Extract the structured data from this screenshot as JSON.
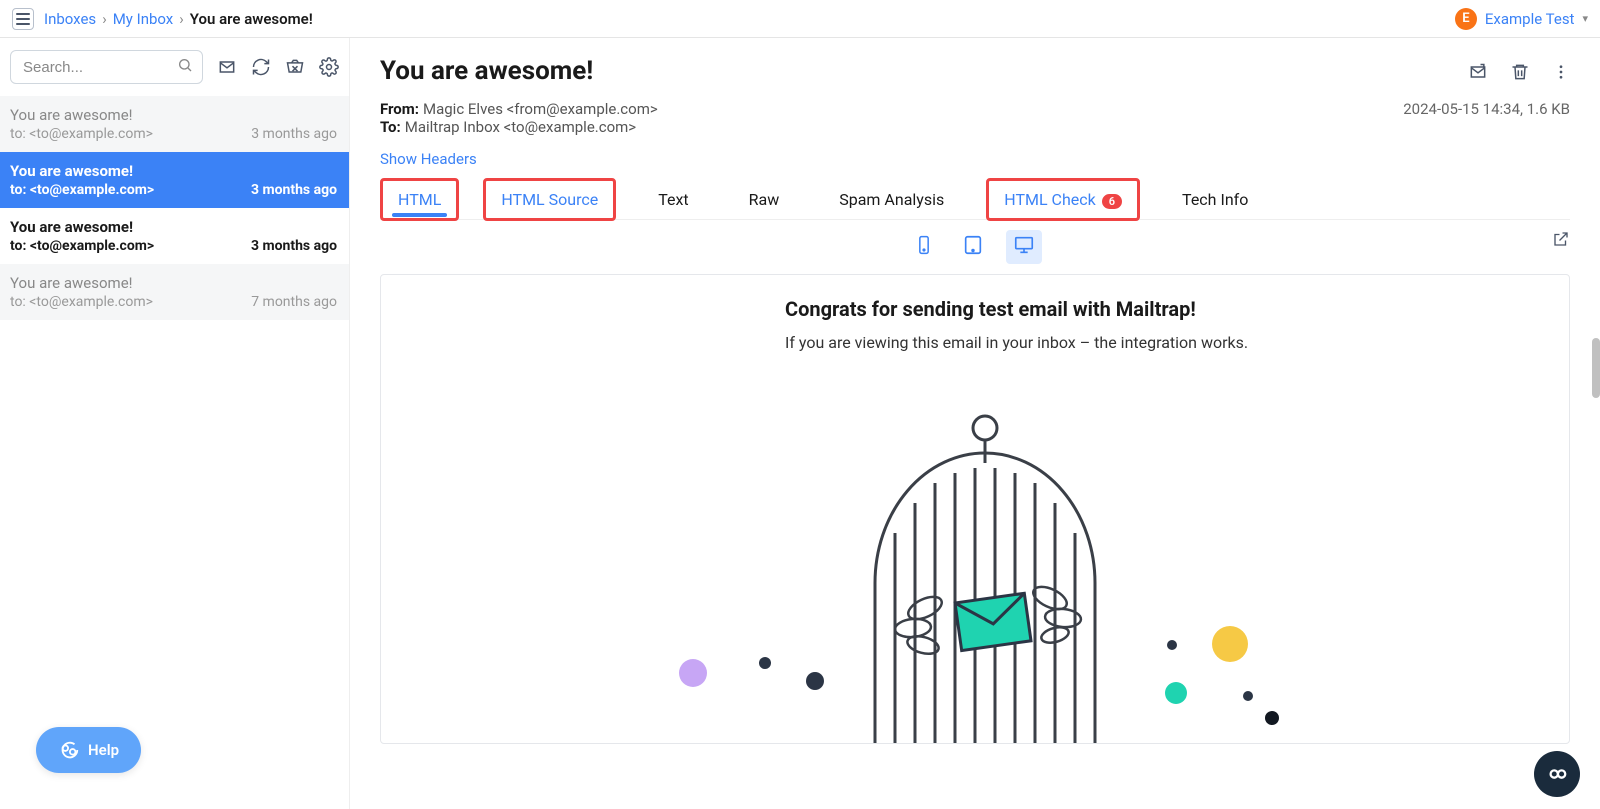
{
  "breadcrumb": {
    "inboxes": "Inboxes",
    "my_inbox": "My Inbox",
    "current": "You are awesome!"
  },
  "user": {
    "initial": "E",
    "name": "Example Test"
  },
  "search": {
    "placeholder": "Search..."
  },
  "messages": [
    {
      "subject": "You are awesome!",
      "to": "to: <to@example.com>",
      "age": "3 months ago",
      "variant": "unread-dim"
    },
    {
      "subject": "You are awesome!",
      "to": "to: <to@example.com>",
      "age": "3 months ago",
      "variant": "selected"
    },
    {
      "subject": "You are awesome!",
      "to": "to: <to@example.com>",
      "age": "3 months ago",
      "variant": "bold"
    },
    {
      "subject": "You are awesome!",
      "to": "to: <to@example.com>",
      "age": "7 months ago",
      "variant": "unread-dim"
    }
  ],
  "email": {
    "subject": "You are awesome!",
    "from_label": "From:",
    "from_value": "Magic Elves <from@example.com>",
    "to_label": "To:",
    "to_value": "Mailtrap Inbox <to@example.com>",
    "timestamp": "2024-05-15 14:34, 1.6 KB",
    "show_headers": "Show Headers"
  },
  "tabs": {
    "html": "HTML",
    "html_source": "HTML Source",
    "text": "Text",
    "raw": "Raw",
    "spam": "Spam Analysis",
    "html_check": "HTML Check",
    "html_check_badge": "6",
    "tech": "Tech Info"
  },
  "preview": {
    "heading": "Congrats for sending test email with Mailtrap!",
    "body": "If you are viewing this email in your inbox – the integration works."
  },
  "help": {
    "label": "Help"
  }
}
